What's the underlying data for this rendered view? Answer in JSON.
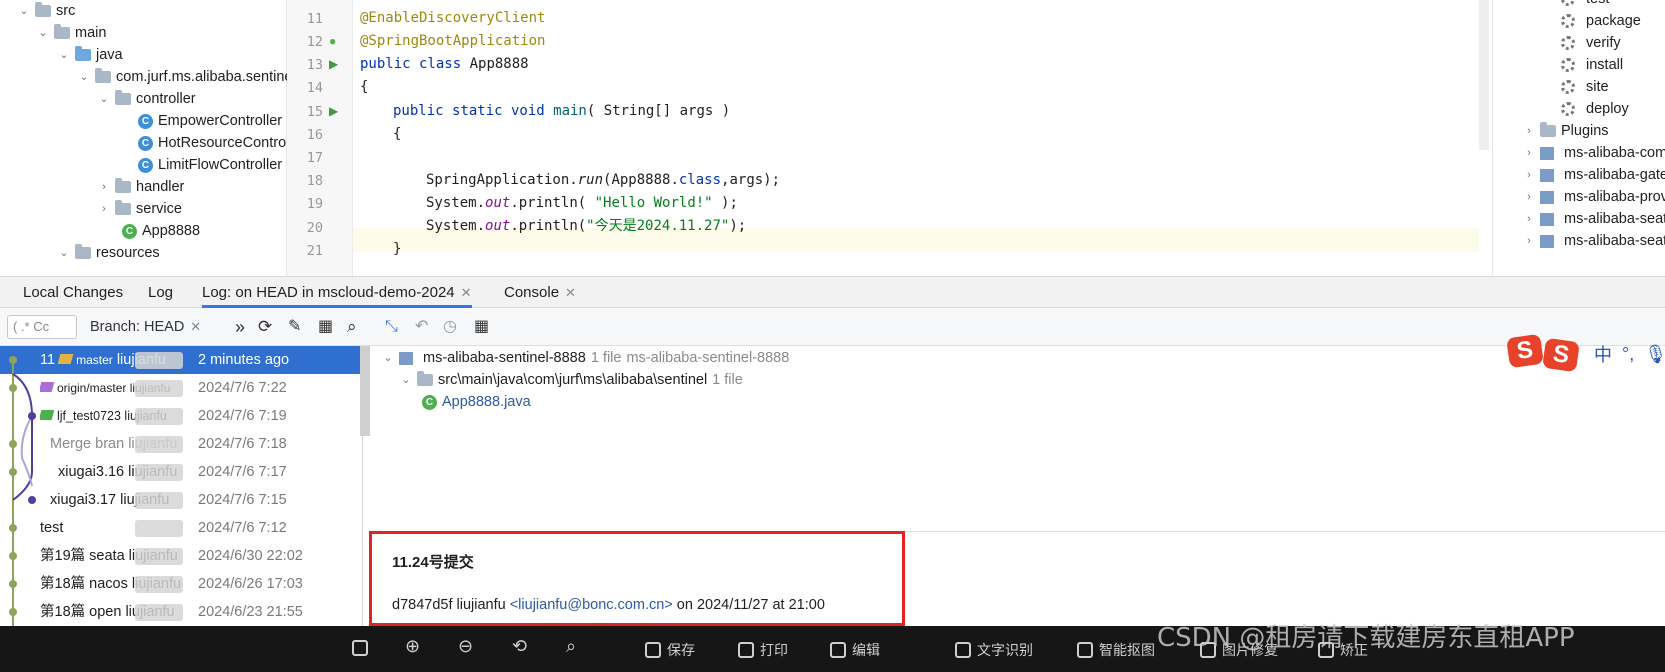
{
  "project_tree": [
    {
      "label": "src",
      "type": "folder",
      "open": true
    },
    {
      "label": "main",
      "type": "folder",
      "open": true
    },
    {
      "label": "java",
      "type": "folder-blue",
      "open": true
    },
    {
      "label": "com.jurf.ms.alibaba.sentinel",
      "type": "package",
      "open": true
    },
    {
      "label": "controller",
      "type": "package",
      "open": true
    },
    {
      "label": "EmpowerController",
      "type": "class"
    },
    {
      "label": "HotResourceController",
      "type": "class"
    },
    {
      "label": "LimitFlowController",
      "type": "class"
    },
    {
      "label": "handler",
      "type": "package",
      "open": false
    },
    {
      "label": "service",
      "type": "package",
      "open": false
    },
    {
      "label": "App8888",
      "type": "springclass"
    },
    {
      "label": "resources",
      "type": "folder",
      "open": true
    }
  ],
  "editor": {
    "line_numbers": [
      "11",
      "12",
      "13",
      "14",
      "15",
      "16",
      "17",
      "18",
      "19",
      "20",
      "21"
    ],
    "lines": {
      "l11": "@EnableDiscoveryClient",
      "l12": "@SpringBootApplication",
      "l13_kw": "public class",
      "l13_name": " App8888",
      "l14": "{",
      "l15_kw": "public static void",
      "l15_fn": " main",
      "l15_rest": "( String[] args )",
      "l16": "{",
      "l18_a": "SpringApplication.",
      "l18_b": "run",
      "l18_c": "(App8888.",
      "l18_d": "class",
      "l18_e": ",args);",
      "l19_a": "System.",
      "l19_b": "out",
      "l19_c": ".println( ",
      "l19_d": "\"Hello World!\"",
      "l19_e": " );",
      "l20_a": "System.",
      "l20_b": "out",
      "l20_c": ".println(",
      "l20_d": "\"今天是2024.11.27\"",
      "l20_e": ");",
      "l21": "}"
    }
  },
  "maven": {
    "lifecycle": [
      "test",
      "package",
      "verify",
      "install",
      "site",
      "deploy"
    ],
    "plugins_label": "Plugins",
    "modules": [
      "ms-alibaba-common",
      "ms-alibaba-gateway",
      "ms-alibaba-provider",
      "ms-alibaba-seata",
      "ms-alibaba-seata"
    ]
  },
  "tabs": {
    "local_changes": "Local Changes",
    "log": "Log",
    "log_head": "Log: on HEAD in mscloud-demo-2024",
    "console": "Console"
  },
  "toolbar": {
    "filter_placeholder": "( .*  Cc",
    "branch": "Branch: HEAD",
    "more": "»"
  },
  "commits": [
    {
      "msg": "11",
      "tag": "master",
      "author": "liujianfu",
      "date": "2 minutes ago",
      "selected": true
    },
    {
      "msg": "origin/master",
      "tag": "origin",
      "author": "liujianfu",
      "date": "2024/7/6 7:22"
    },
    {
      "msg": "ljf_test0723",
      "tag": "ljf",
      "author": "liujianfu",
      "date": "2024/7/6 7:19"
    },
    {
      "msg": "Merge bran",
      "author": "liujianfu",
      "date": "2024/7/6 7:18",
      "merge": true
    },
    {
      "msg": "xiugai3.16",
      "author": "liujianfu",
      "date": "2024/7/6 7:17"
    },
    {
      "msg": "xiugai3.17",
      "author": "liujianfu",
      "date": "2024/7/6 7:15"
    },
    {
      "msg": "test",
      "author": "",
      "date": "2024/7/6 7:12"
    },
    {
      "msg": "第19篇 seata",
      "author": "liujianfu",
      "date": "2024/6/30 22:02"
    },
    {
      "msg": "第18篇 nacos",
      "author": "liujianfu",
      "date": "2024/6/26 17:03"
    },
    {
      "msg": "第18篇 open",
      "author": "liujianfu",
      "date": "2024/6/23 21:55"
    }
  ],
  "changes": {
    "module": "ms-alibaba-sentinel-8888",
    "module_count": "1 file",
    "module_path": "ms-alibaba-sentinel-8888",
    "dir": "src\\main\\java\\com\\jurf\\ms\\alibaba\\sentinel",
    "dir_count": "1 file",
    "file": "App8888.java"
  },
  "details": {
    "title": "11.24号提交",
    "hash": "d7847d5f",
    "author": "liujianfu",
    "email": "<liujianfu@bonc.com.cn>",
    "when": "on 2024/11/27 at 21:00"
  },
  "ime": {
    "lang": "中",
    "punct": "°,"
  },
  "viewer_bar": [
    "保存",
    "打印",
    "编辑",
    "文字识别",
    "智能抠图",
    "图片修复",
    "矫正"
  ],
  "watermark": "CSDN @租房请下载建房东直租APP"
}
